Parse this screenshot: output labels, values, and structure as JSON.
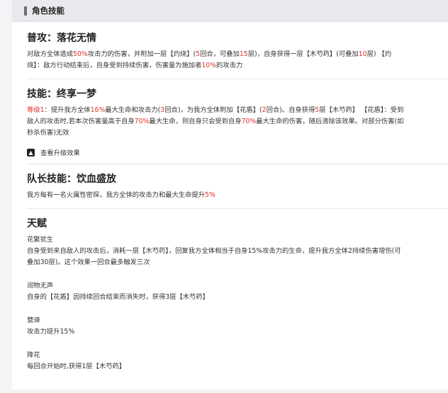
{
  "panel_title": "角色技能",
  "normal_attack": {
    "title": "普攻：落花无情",
    "l1": [
      "对敌方全体造成",
      "50%",
      "攻击力的伤害，并附加一层【灼烧】(",
      "5",
      "回合，可叠加",
      "15",
      "层)，自身获得一层【木芍药】(可叠加",
      "10",
      "层) 【灼"
    ],
    "l2": [
      "烧】：敌方行动结束后，自身受到持续伤害，伤害量为施加者",
      "10%",
      "的攻击力"
    ]
  },
  "skill": {
    "title": "技能：终享一梦",
    "l1": [
      "等级1",
      "：提升我方全体",
      "16%",
      "最大生命和攻击力(",
      "3",
      "回合)，为我方全体附加【花盾】(",
      "2",
      "回合)。自身获得",
      "5",
      "层【木芍药】 【花盾】：受到"
    ],
    "l2": [
      "敌人的攻击时,若本次伤害量高于自身",
      "70%",
      "最大生命，则自身只会受到自身",
      "70%",
      "最大生命的伤害，随后清除该效果。对部分伤害(如"
    ],
    "l3": "秒杀伤害)无效",
    "upgrade_label": "查看升级效果"
  },
  "leader": {
    "title": "队长技能：饮血盛放",
    "l1": [
      "我方每有一名火属性密探，我方全体的攻击力和最大生命提升",
      "5%"
    ]
  },
  "talent": {
    "title": "天赋",
    "items": [
      {
        "name": "花繁犹生",
        "lines": [
          "自身受到来自敌人的攻击后，消耗一层【木芍药】，回复我方全体相当于自身15%攻击力的生命，提升我方全体2持续伤害增伤(可",
          "叠加30层)。这个效果一回合最多触发三次"
        ]
      },
      {
        "name": "润物无声",
        "lines": [
          "自身的【花盾】因持续回合结束而消失时，获得3层【木芍药】"
        ]
      },
      {
        "name": "营谛",
        "lines": [
          "攻击力提升15%"
        ]
      },
      {
        "name": "降花",
        "lines": [
          "每回合开始时,获得1层【木芍药】"
        ]
      }
    ]
  },
  "colors": {
    "accent_red": "#e0322b",
    "header_bar": "#6b6f80"
  },
  "icons": {
    "upgrade": "up-arrow-square-icon"
  }
}
